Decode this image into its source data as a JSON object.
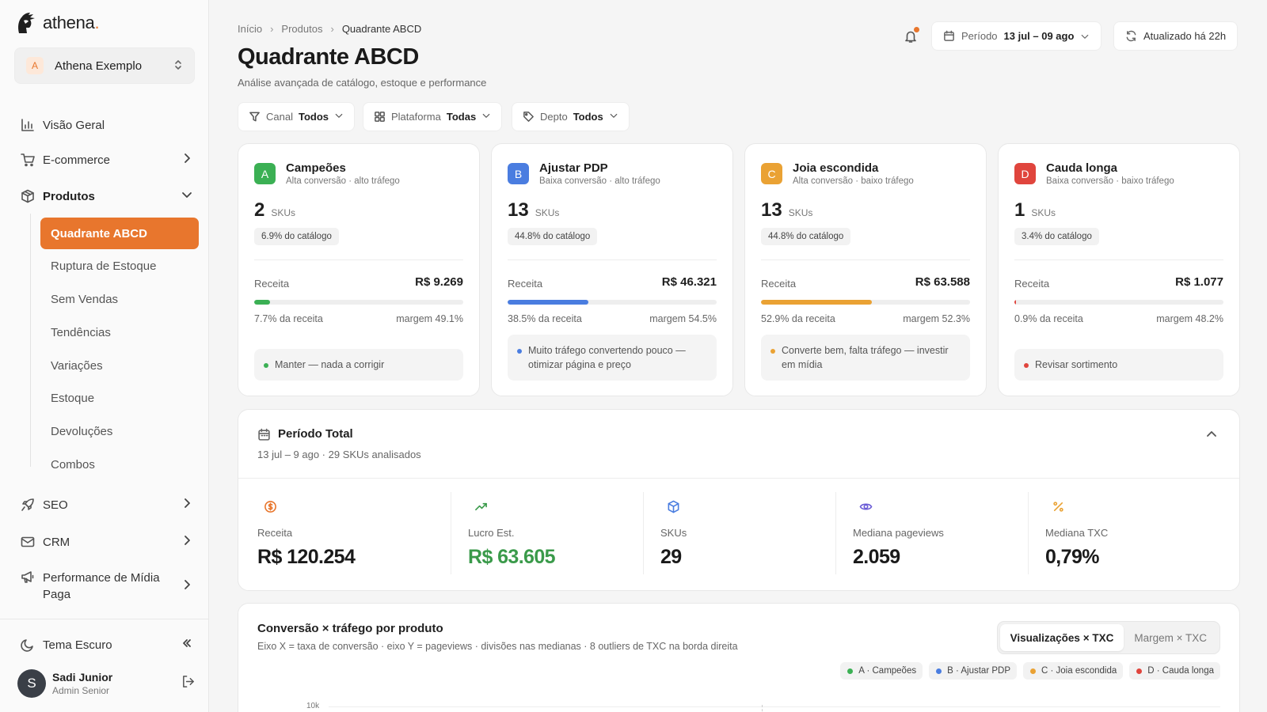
{
  "app": {
    "name": "athena",
    "dot": "."
  },
  "workspace": {
    "initial": "A",
    "name": "Athena Exemplo"
  },
  "sidebar": {
    "items": [
      {
        "label": "Visão Geral"
      },
      {
        "label": "E-commerce"
      },
      {
        "label": "Produtos"
      },
      {
        "label": "SEO"
      },
      {
        "label": "CRM"
      },
      {
        "label": "Performance de Mídia Paga"
      }
    ],
    "sub_items": [
      {
        "label": "Quadrante ABCD"
      },
      {
        "label": "Ruptura de Estoque"
      },
      {
        "label": "Sem Vendas"
      },
      {
        "label": "Tendências"
      },
      {
        "label": "Variações"
      },
      {
        "label": "Estoque"
      },
      {
        "label": "Devoluções"
      },
      {
        "label": "Combos"
      }
    ],
    "theme_label": "Tema Escuro",
    "user": {
      "initial": "S",
      "name": "Sadi Junior",
      "role": "Admin Senior"
    }
  },
  "breadcrumb": [
    "Início",
    "Produtos",
    "Quadrante ABCD"
  ],
  "page": {
    "title": "Quadrante ABCD",
    "subtitle": "Análise avançada de catálogo, estoque e performance"
  },
  "header": {
    "period_label": "Período",
    "period_value": "13 jul – 09 ago",
    "updated": "Atualizado há 22h"
  },
  "filters": [
    {
      "label": "Canal",
      "value": "Todos"
    },
    {
      "label": "Plataforma",
      "value": "Todas"
    },
    {
      "label": "Depto",
      "value": "Todos"
    }
  ],
  "quadrants": [
    {
      "letter": "A",
      "title": "Campeões",
      "desc": "Alta conversão · alto tráfego",
      "count": "2",
      "unit": "SKUs",
      "share": "6.9% do catálogo",
      "revenue_label": "Receita",
      "revenue": "R$ 9.269",
      "revenue_share": 0.077,
      "pct": "7.7% da receita",
      "margin": "margem 49.1%",
      "action": "Manter — nada a corrigir",
      "color": "#3bb054"
    },
    {
      "letter": "B",
      "title": "Ajustar PDP",
      "desc": "Baixa conversão · alto tráfego",
      "count": "13",
      "unit": "SKUs",
      "share": "44.8% do catálogo",
      "revenue_label": "Receita",
      "revenue": "R$ 46.321",
      "revenue_share": 0.385,
      "pct": "38.5% da receita",
      "margin": "margem 54.5%",
      "action": "Muito tráfego convertendo pouco — otimizar página e preço",
      "color": "#4a7de0"
    },
    {
      "letter": "C",
      "title": "Joia escondida",
      "desc": "Alta conversão · baixo tráfego",
      "count": "13",
      "unit": "SKUs",
      "share": "44.8% do catálogo",
      "revenue_label": "Receita",
      "revenue": "R$ 63.588",
      "revenue_share": 0.529,
      "pct": "52.9% da receita",
      "margin": "margem 52.3%",
      "action": "Converte bem, falta tráfego — investir em mídia",
      "color": "#eaa234"
    },
    {
      "letter": "D",
      "title": "Cauda longa",
      "desc": "Baixa conversão · baixo tráfego",
      "count": "1",
      "unit": "SKUs",
      "share": "3.4% do catálogo",
      "revenue_label": "Receita",
      "revenue": "R$ 1.077",
      "revenue_share": 0.009,
      "pct": "0.9% da receita",
      "margin": "margem 48.2%",
      "action": "Revisar sortimento",
      "color": "#e0453d"
    }
  ],
  "period_total": {
    "title": "Período Total",
    "subtitle": "13 jul – 9 ago · 29 SKUs analisados",
    "metrics": [
      {
        "label": "Receita",
        "value": "R$ 120.254",
        "icon": "dollar-circle-icon"
      },
      {
        "label": "Lucro Est.",
        "value": "R$ 63.605",
        "icon": "trending-up-icon"
      },
      {
        "label": "SKUs",
        "value": "29",
        "icon": "box-icon"
      },
      {
        "label": "Mediana pageviews",
        "value": "2.059",
        "icon": "eye-icon"
      },
      {
        "label": "Mediana TXC",
        "value": "0,79%",
        "icon": "percent-icon"
      }
    ]
  },
  "scatter": {
    "title": "Conversão × tráfego por produto",
    "subtitle": "Eixo X = taxa de conversão · eixo Y = pageviews · divisões nas medianas · 8 outliers de TXC na borda direita",
    "toggle": [
      "Visualizações × TXC",
      "Margem × TXC"
    ],
    "legend": [
      {
        "label": "A · Campeões",
        "color": "#3bb054"
      },
      {
        "label": "B · Ajustar PDP",
        "color": "#4a7de0"
      },
      {
        "label": "C · Joia escondida",
        "color": "#eaa234"
      },
      {
        "label": "D · Cauda longa",
        "color": "#e0453d"
      }
    ],
    "y_tick": "10k"
  },
  "colors": {
    "accent": "#e8762d",
    "positive": "#3a9a4a"
  }
}
